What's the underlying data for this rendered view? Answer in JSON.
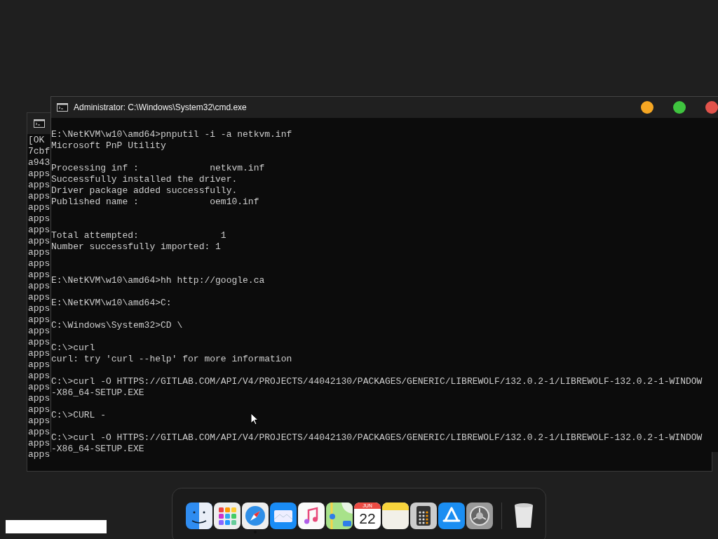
{
  "background_window": {
    "lines": [
      "[OK",
      "7cbf",
      "a943",
      "apps",
      "apps",
      "apps",
      "apps",
      "apps",
      "apps",
      "apps",
      "apps",
      "apps",
      "apps",
      "apps",
      "apps",
      "apps",
      "apps",
      "apps",
      "apps",
      "apps",
      "apps",
      "apps",
      "apps",
      "apps",
      "apps",
      "apps",
      "apps",
      "apps",
      "apps"
    ]
  },
  "window": {
    "title": "Administrator: C:\\Windows\\System32\\cmd.exe",
    "controls": [
      {
        "color": "#f5a623"
      },
      {
        "color": "#3fc43f"
      },
      {
        "color": "#e2534b"
      }
    ],
    "output": "E:\\NetKVM\\w10\\amd64>pnputil -i -a netkvm.inf\nMicrosoft PnP Utility\n\nProcessing inf :             netkvm.inf\nSuccessfully installed the driver.\nDriver package added successfully.\nPublished name :             oem10.inf\n\n\nTotal attempted:               1\nNumber successfully imported: 1\n\n\nE:\\NetKVM\\w10\\amd64>hh http://google.ca\n\nE:\\NetKVM\\w10\\amd64>C:\n\nC:\\Windows\\System32>CD \\\n\nC:\\>curl\ncurl: try 'curl --help' for more information\n\nC:\\>curl -O HTTPS://GITLAB.COM/API/V4/PROJECTS/44042130/PACKAGES/GENERIC/LIBREWOLF/132.0.2-1/LIBREWOLF-132.0.2-1-WINDOW\n-X86_64-SETUP.EXE\n\nC:\\>CURL -\n\nC:\\>curl -O HTTPS://GITLAB.COM/API/V4/PROJECTS/44042130/PACKAGES/GENERIC/LIBREWOLF/132.0.2-1/LIBREWOLF-132.0.2-1-WINDOW\n-X86_64-SETUP.EXE"
  },
  "dock": {
    "apps": [
      {
        "kind": "finder",
        "running": false
      },
      {
        "kind": "launchpad",
        "running": false
      },
      {
        "kind": "safari",
        "running": true
      },
      {
        "kind": "mail",
        "running": false
      },
      {
        "kind": "music",
        "running": false
      },
      {
        "kind": "maps",
        "running": false
      },
      {
        "kind": "calendar",
        "running": false,
        "month": "JUN",
        "day": "22"
      },
      {
        "kind": "notes",
        "running": false
      },
      {
        "kind": "calculator",
        "running": false
      },
      {
        "kind": "appstore",
        "running": false
      },
      {
        "kind": "settings",
        "running": false
      }
    ],
    "trash": {
      "kind": "trash"
    }
  }
}
